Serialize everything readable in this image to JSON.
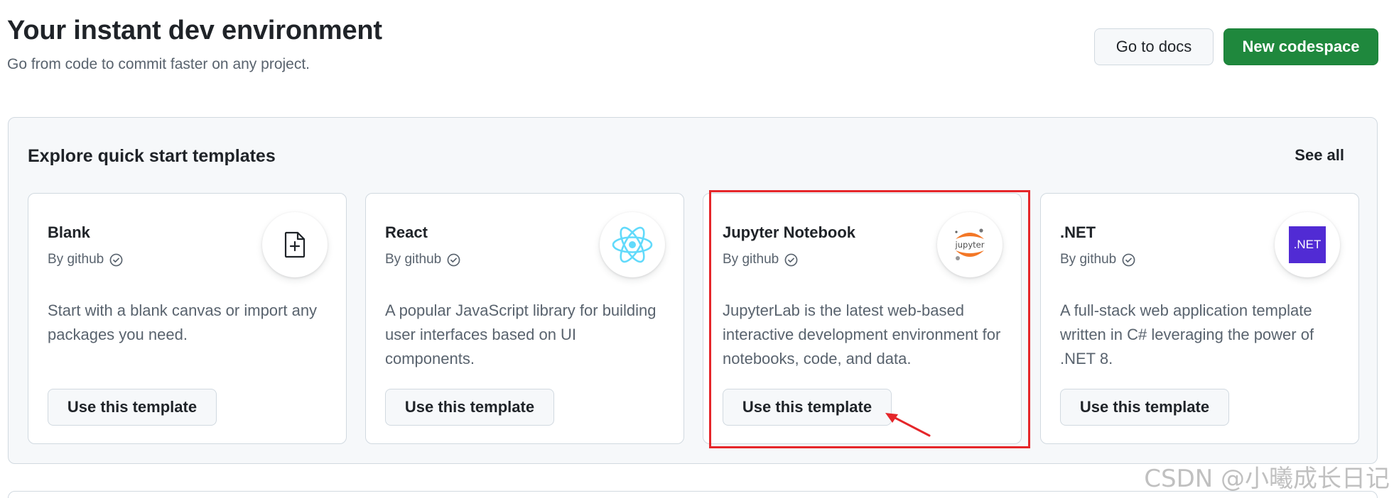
{
  "header": {
    "title": "Your instant dev environment",
    "subtitle": "Go from code to commit faster on any project.",
    "docs_label": "Go to docs",
    "new_label": "New codespace"
  },
  "templates": {
    "title": "Explore quick start templates",
    "see_all": "See all",
    "cards": [
      {
        "name": "Blank",
        "by": "By github",
        "icon": "file-plus-icon",
        "description": "Start with a blank canvas or import any packages you need.",
        "button": "Use this template"
      },
      {
        "name": "React",
        "by": "By github",
        "icon": "react-logo-icon",
        "description": "A popular JavaScript library for building user interfaces based on UI components.",
        "button": "Use this template"
      },
      {
        "name": "Jupyter Notebook",
        "by": "By github",
        "icon": "jupyter-logo-icon",
        "logo_text": "jupyter",
        "description": "JupyterLab is the latest web-based interactive development environment for notebooks, code, and data.",
        "button": "Use this template"
      },
      {
        "name": ".NET",
        "by": "By github",
        "icon": "dotnet-logo-icon",
        "logo_text": ".NET",
        "description": "A full-stack web application template written in C# leveraging the power of .NET 8.",
        "button": "Use this template"
      }
    ]
  },
  "watermark": "CSDN @小曦成长日记",
  "colors": {
    "primary": "#1f883d",
    "highlight": "#e5262a",
    "react": "#61dafb",
    "jupyter": "#f37726",
    "dotnet": "#512bd4"
  }
}
